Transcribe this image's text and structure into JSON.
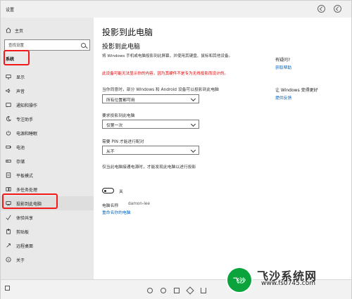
{
  "window": {
    "title": "设置"
  },
  "sidebar": {
    "home": "主页",
    "search_placeholder": "查找设置",
    "section": "系统",
    "items": [
      {
        "label": "显示",
        "icon": "display-icon"
      },
      {
        "label": "声音",
        "icon": "speaker-icon"
      },
      {
        "label": "通知和操作",
        "icon": "notification-icon"
      },
      {
        "label": "专注助手",
        "icon": "moon-icon"
      },
      {
        "label": "电源和睡眠",
        "icon": "power-icon"
      },
      {
        "label": "电池",
        "icon": "battery-icon"
      },
      {
        "label": "存储",
        "icon": "storage-icon"
      },
      {
        "label": "平板模式",
        "icon": "tablet-icon"
      },
      {
        "label": "多任务处理",
        "icon": "multitask-icon"
      },
      {
        "label": "投影到此电脑",
        "icon": "project-icon"
      },
      {
        "label": "体验共享",
        "icon": "share-icon"
      },
      {
        "label": "剪贴板",
        "icon": "clipboard-icon"
      },
      {
        "label": "远程桌面",
        "icon": "remote-icon"
      },
      {
        "label": "关于",
        "icon": "info-icon"
      }
    ],
    "selected": "投影到此电脑"
  },
  "main": {
    "header": "投影到此电脑",
    "title": "投影到此电脑",
    "description": "将 Windows 手机或电脑投影到此屏幕，并使用其键盘、鼠标和其他设备。",
    "warning": "此设备可能无法显示你的内容，因为其硬件不是专为无线投影而设计的。",
    "permission_label": "当你同意时，部分 Windows 和 Android 设备可以投影到此电脑",
    "permission_value": "所有位置都可用",
    "request_label": "要求投影到此电脑",
    "request_value": "仅第一次",
    "pin_label": "需要 PIN 才能进行配对",
    "pin_value": "从不",
    "power_label": "仅当此电脑接通电源时，才能发现此电脑以进行投影",
    "toggle_state": "关",
    "pc_name_label": "电脑名称",
    "pc_name_value": "damon-lee",
    "rename_link": "重命名你的电脑"
  },
  "aside": {
    "question": "有疑问?",
    "help_link": "获取帮助",
    "improve": "让 Windows 变得更好",
    "feedback_link": "提供反馈"
  },
  "watermark": {
    "logo_text": "飞沙",
    "title": "飞沙系统网",
    "url": "www.fs0745.com"
  },
  "colors": {
    "highlight": "#f2191b",
    "link": "#0067c0",
    "warning": "#e00000"
  }
}
